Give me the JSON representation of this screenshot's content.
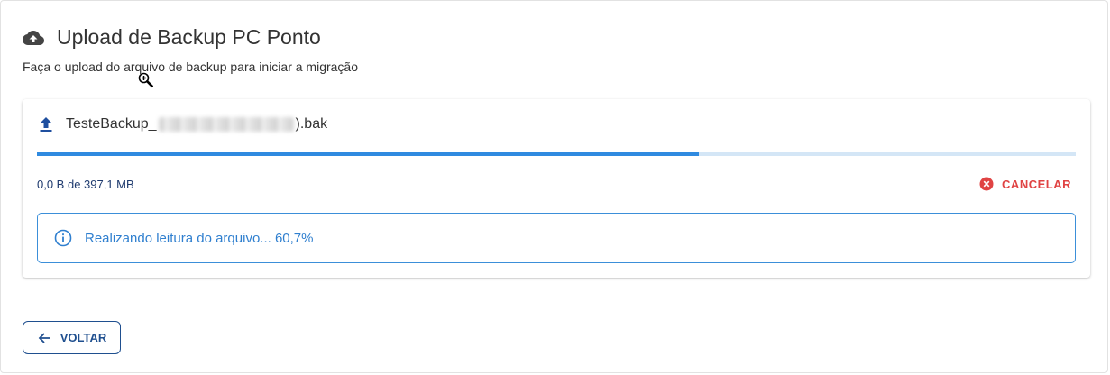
{
  "page": {
    "title": "Upload de Backup PC Ponto",
    "subtitle": "Faça o upload do arquivo de backup para iniciar a migração"
  },
  "upload": {
    "file_prefix": "TesteBackup_",
    "file_suffix": ").bak",
    "progress_fraction": 0.637,
    "size_text": "0,0 B de 397,1 MB",
    "cancel_label": "CANCELAR",
    "status_message": "Realizando leitura do arquivo... 60,7%"
  },
  "actions": {
    "back_label": "VOLTAR"
  },
  "icons": {
    "header": "cloud-upload-icon",
    "file": "upload-arrow-icon",
    "cancel": "close-circle-icon",
    "info": "info-circle-icon",
    "back": "arrow-left-icon",
    "cursor": "zoom-in-cursor-icon"
  },
  "colors": {
    "progress_fill": "#2f8ae0",
    "progress_track": "#d4e6f6",
    "info_border": "#3b8fd9",
    "cancel": "#e04343",
    "primary_dark": "#1f4f8f"
  }
}
